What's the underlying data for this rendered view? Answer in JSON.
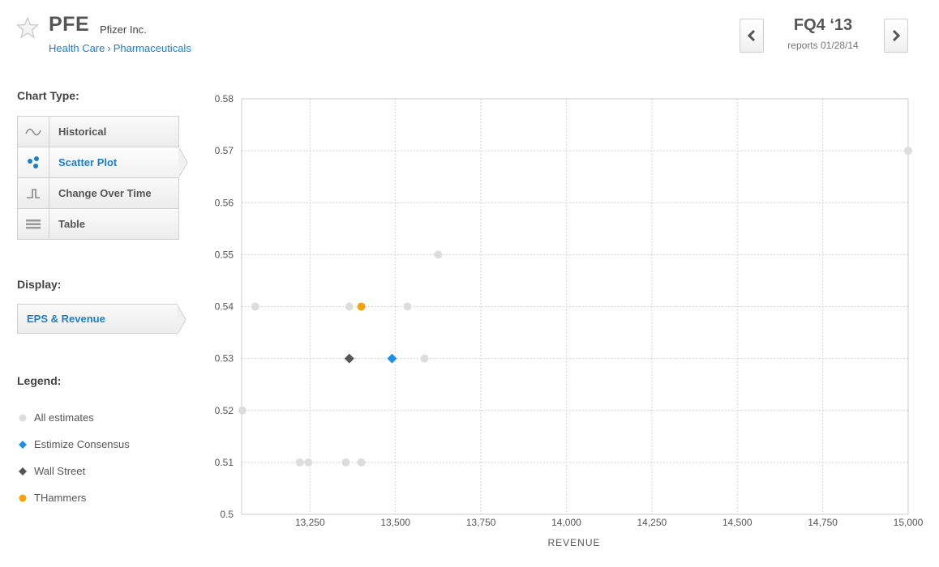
{
  "header": {
    "ticker": "PFE",
    "company": "Pfizer Inc.",
    "sector": "Health Care",
    "separator": "›",
    "industry": "Pharmaceuticals",
    "quarter": "FQ4 ‘13",
    "report_date": "reports 01/28/14",
    "prev_icon": "chevron-left-icon",
    "next_icon": "chevron-right-icon",
    "favorite_icon": "star-icon"
  },
  "sidebar": {
    "chart_type_label": "Chart Type:",
    "chart_types": [
      {
        "label": "Historical",
        "icon": "wave-icon",
        "active": false
      },
      {
        "label": "Scatter Plot",
        "icon": "scatter-icon",
        "active": true
      },
      {
        "label": "Change Over Time",
        "icon": "step-icon",
        "active": false
      },
      {
        "label": "Table",
        "icon": "table-icon",
        "active": false
      }
    ],
    "display_label": "Display:",
    "display_value": "EPS & Revenue",
    "legend_label": "Legend:",
    "legend": [
      {
        "label": "All estimates",
        "shape": "circle",
        "color": "#dddddd"
      },
      {
        "label": "Estimize Consensus",
        "shape": "diamond",
        "color": "#1f8fe3"
      },
      {
        "label": "Wall Street",
        "shape": "diamond",
        "color": "#555555"
      },
      {
        "label": "THammers",
        "shape": "circle",
        "color": "#f5a30a"
      }
    ]
  },
  "colors": {
    "accent": "#1f7ec1",
    "estimate": "#dddddd",
    "consensus": "#1f8fe3",
    "wall_street": "#555555",
    "user": "#f5a30a"
  },
  "chart_data": {
    "type": "scatter",
    "xlabel": "REVENUE",
    "ylabel": "",
    "xlim": [
      13050,
      15000
    ],
    "ylim": [
      0.5,
      0.58
    ],
    "x_ticks": [
      13250,
      13500,
      13750,
      14000,
      14250,
      14500,
      14750,
      15000
    ],
    "x_tick_labels": [
      "13,250",
      "13,500",
      "13,750",
      "14,000",
      "14,250",
      "14,500",
      "14,750",
      "15,000"
    ],
    "y_ticks": [
      0.5,
      0.51,
      0.52,
      0.53,
      0.54,
      0.55,
      0.56,
      0.57,
      0.58
    ],
    "y_tick_labels": [
      "0.5",
      "0.51",
      "0.52",
      "0.53",
      "0.54",
      "0.55",
      "0.56",
      "0.57",
      "0.58"
    ],
    "grid": true,
    "series": [
      {
        "name": "All estimates",
        "shape": "circle",
        "color": "#dddddd",
        "points": [
          {
            "x": 15000,
            "y": 0.57
          },
          {
            "x": 13625,
            "y": 0.55
          },
          {
            "x": 13090,
            "y": 0.54
          },
          {
            "x": 13365,
            "y": 0.54
          },
          {
            "x": 13535,
            "y": 0.54
          },
          {
            "x": 13585,
            "y": 0.53
          },
          {
            "x": 13052,
            "y": 0.52
          },
          {
            "x": 13220,
            "y": 0.51
          },
          {
            "x": 13245,
            "y": 0.51
          },
          {
            "x": 13355,
            "y": 0.51
          },
          {
            "x": 13400,
            "y": 0.51
          }
        ]
      },
      {
        "name": "Estimize Consensus",
        "shape": "diamond",
        "color": "#1f8fe3",
        "points": [
          {
            "x": 13490,
            "y": 0.53
          }
        ]
      },
      {
        "name": "Wall Street",
        "shape": "diamond",
        "color": "#555555",
        "points": [
          {
            "x": 13365,
            "y": 0.53
          }
        ]
      },
      {
        "name": "THammers",
        "shape": "circle",
        "color": "#f5a30a",
        "points": [
          {
            "x": 13400,
            "y": 0.54
          }
        ]
      }
    ]
  }
}
